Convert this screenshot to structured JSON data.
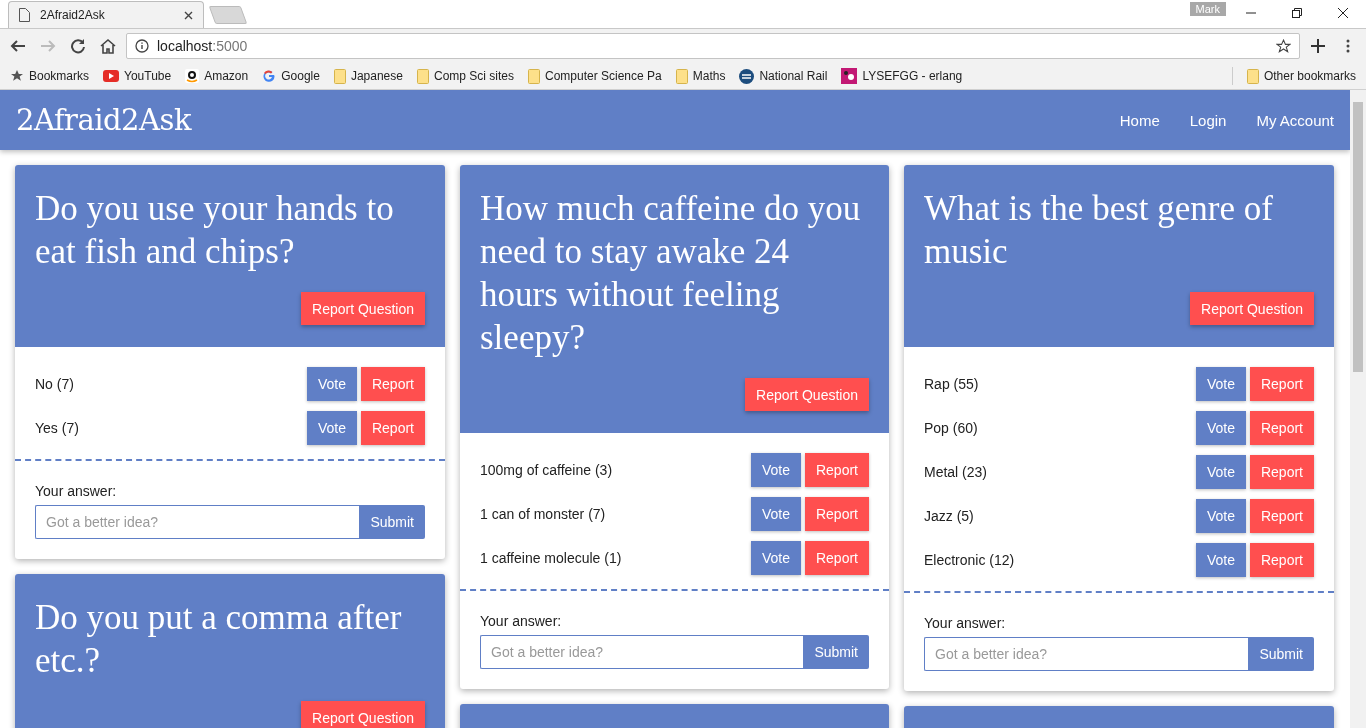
{
  "browser": {
    "tab_title": "2Afraid2Ask",
    "profile": "Mark",
    "url_host": "localhost",
    "url_port": ":5000",
    "bookmarks": [
      {
        "kind": "star",
        "label": "Bookmarks"
      },
      {
        "kind": "youtube",
        "label": "YouTube"
      },
      {
        "kind": "amazon",
        "label": "Amazon"
      },
      {
        "kind": "google",
        "label": "Google"
      },
      {
        "kind": "folder",
        "label": "Japanese"
      },
      {
        "kind": "folder",
        "label": "Comp Sci sites"
      },
      {
        "kind": "folder",
        "label": "Computer Science Pa"
      },
      {
        "kind": "folder",
        "label": "Maths"
      },
      {
        "kind": "rail",
        "label": "National Rail"
      },
      {
        "kind": "game",
        "label": "LYSEFGG - erlang"
      }
    ],
    "other_bookmarks": "Other bookmarks"
  },
  "site": {
    "brand": "2Afraid2Ask",
    "nav": [
      "Home",
      "Login",
      "My Account"
    ],
    "columns": [
      [
        {
          "kind": "question",
          "question": "Do you use your hands to eat fish and chips?",
          "report_label": "Report Question",
          "answers": [
            {
              "label": "No (7)",
              "vote": "Vote",
              "report": "Report"
            },
            {
              "label": "Yes (7)",
              "vote": "Vote",
              "report": "Report"
            }
          ],
          "answer_label": "Your answer:",
          "placeholder": "Got a better idea?",
          "submit": "Submit"
        },
        {
          "kind": "question",
          "question": "Do you put a comma after etc.?",
          "report_label": "Report Question"
        }
      ],
      [
        {
          "kind": "question",
          "question": "How much caffeine do you need to stay awake 24 hours without feeling sleepy?",
          "report_label": "Report Question",
          "answers": [
            {
              "label": "100mg of caffeine (3)",
              "vote": "Vote",
              "report": "Report"
            },
            {
              "label": "1 can of monster (7)",
              "vote": "Vote",
              "report": "Report"
            },
            {
              "label": "1 caffeine molecule (1)",
              "vote": "Vote",
              "report": "Report"
            }
          ],
          "answer_label": "Your answer:",
          "placeholder": "Got a better idea?",
          "submit": "Submit"
        },
        {
          "kind": "stub"
        }
      ],
      [
        {
          "kind": "question",
          "question": "What is the best genre of music",
          "report_label": "Report Question",
          "answers": [
            {
              "label": "Rap (55)",
              "vote": "Vote",
              "report": "Report"
            },
            {
              "label": "Pop (60)",
              "vote": "Vote",
              "report": "Report"
            },
            {
              "label": "Metal (23)",
              "vote": "Vote",
              "report": "Report"
            },
            {
              "label": "Jazz (5)",
              "vote": "Vote",
              "report": "Report"
            },
            {
              "label": "Electronic (12)",
              "vote": "Vote",
              "report": "Report"
            }
          ],
          "answer_label": "Your answer:",
          "placeholder": "Got a better idea?",
          "submit": "Submit"
        },
        {
          "kind": "stub"
        }
      ]
    ]
  }
}
